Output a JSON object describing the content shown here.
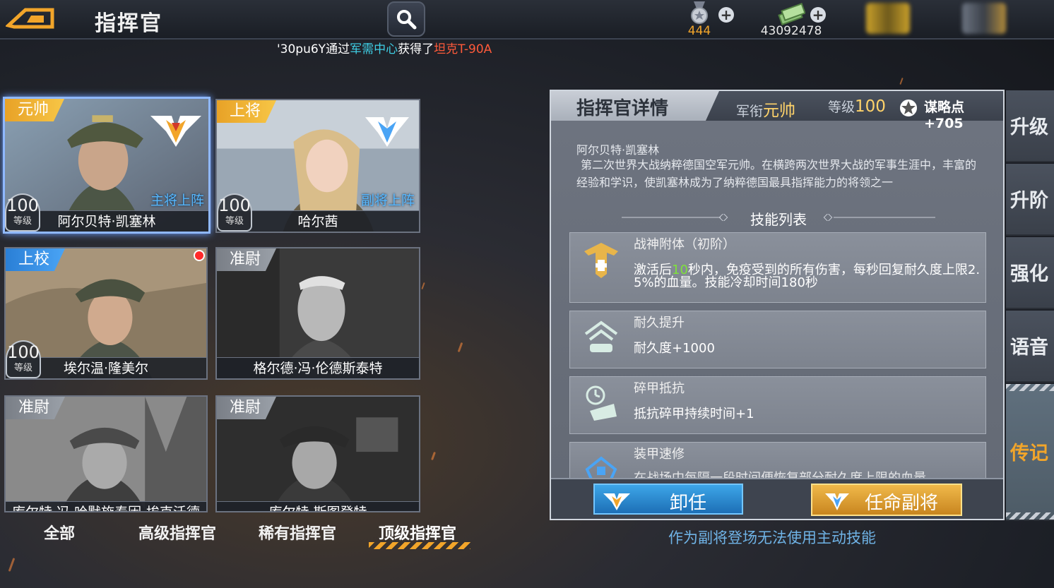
{
  "header": {
    "title": "指挥官",
    "medals": "444",
    "cash": "43092478",
    "plus": "+"
  },
  "ticker": {
    "player": "'30pu6Y",
    "via": "通过",
    "source": "军需中心",
    "got": "获得了",
    "item": "坦克T-90A"
  },
  "commanders": [
    {
      "rank": "元帅",
      "name": "阿尔贝特·凯塞林",
      "level": "100",
      "level_label": "等级",
      "deploy": "主将上阵"
    },
    {
      "rank": "上将",
      "name": "哈尔茜",
      "level": "100",
      "level_label": "等级",
      "deploy": "副将上阵"
    },
    {
      "rank": "上校",
      "name": "埃尔温·隆美尔",
      "level": "100",
      "level_label": "等级"
    },
    {
      "rank": "准尉",
      "name": "格尔德·冯·伦德斯泰特"
    },
    {
      "rank": "准尉",
      "name": "库尔特·冯·哈默施泰因-埃克沃德"
    },
    {
      "rank": "准尉",
      "name": "库尔特·斯图登特"
    }
  ],
  "tabs": [
    "全部",
    "高级指挥官",
    "稀有指挥官",
    "顶级指挥官"
  ],
  "detail": {
    "title": "指挥官详情",
    "rank_label": "军衔",
    "rank_value": "元帅",
    "level_label": "等级",
    "level_value": "100",
    "strategy": "谋略点+705",
    "name": "阿尔贝特·凯塞林",
    "description": "第二次世界大战纳粹德国空军元帅。在横跨两次世界大战的军事生涯中，丰富的经验和学识，使凯塞林成为了纳粹德国最具指挥能力的将领之一",
    "skills_title": "技能列表",
    "skills": [
      {
        "name": "战神附体（初阶）",
        "desc_pre": "激活后",
        "desc_hl": "10",
        "desc_post": "秒内，免疫受到的所有伤害，每秒回复耐久度上限2.",
        "desc_line2": "5%的血量。技能冷却时间180秒"
      },
      {
        "name": "耐久提升",
        "desc": "耐久度+1000"
      },
      {
        "name": "碎甲抵抗",
        "desc": "抵抗碎甲持续时间+1"
      },
      {
        "name": "装甲速修",
        "desc": "在战场中每隔一段时间便恢复部分耐久度上限的血量"
      }
    ],
    "dismiss": "卸任",
    "appoint": "任命副将",
    "note": "作为副将登场无法使用主动技能"
  },
  "side_tabs": [
    "升级",
    "升阶",
    "强化",
    "语音",
    "传记"
  ],
  "colors": {
    "accent_gold": "#f7c646",
    "accent_blue": "#4aa4f5",
    "deploy_text": "#57b8ff"
  }
}
